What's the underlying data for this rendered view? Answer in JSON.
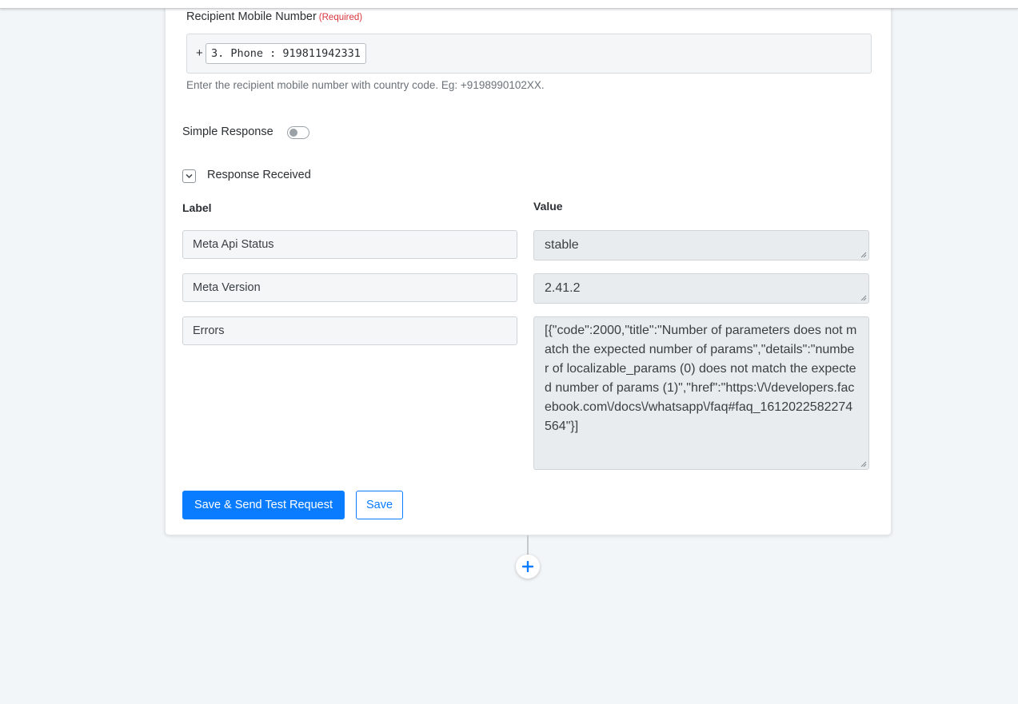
{
  "recipient": {
    "label": "Recipient Mobile Number",
    "required": "(Required)",
    "prefix": "+",
    "token": "3. Phone : 919811942331",
    "hint": "Enter the recipient mobile number with country code. Eg: +9198990102XX."
  },
  "simple_response": {
    "label": "Simple Response",
    "enabled": false
  },
  "response_received": {
    "title": "Response Received",
    "expanded": true,
    "label_header": "Label",
    "value_header": "Value",
    "rows": [
      {
        "label": "Meta Api Status",
        "value": "stable"
      },
      {
        "label": "Meta Version",
        "value": "2.41.2"
      },
      {
        "label": "Errors",
        "value": "[{\"code\":2000,\"title\":\"Number of parameters does not match the expected number of params\",\"details\":\"number of localizable_params (0) does not match the expected number of params (1)\",\"href\":\"https:\\/\\/developers.facebook.com\\/docs\\/whatsapp\\/faq#faq_1612022582274564\"}]"
      }
    ]
  },
  "actions": {
    "save_and_send": "Save & Send Test Request",
    "save": "Save"
  },
  "colors": {
    "primary": "#0a7cff",
    "required": "#d9363e",
    "background": "#f3f6f9"
  }
}
